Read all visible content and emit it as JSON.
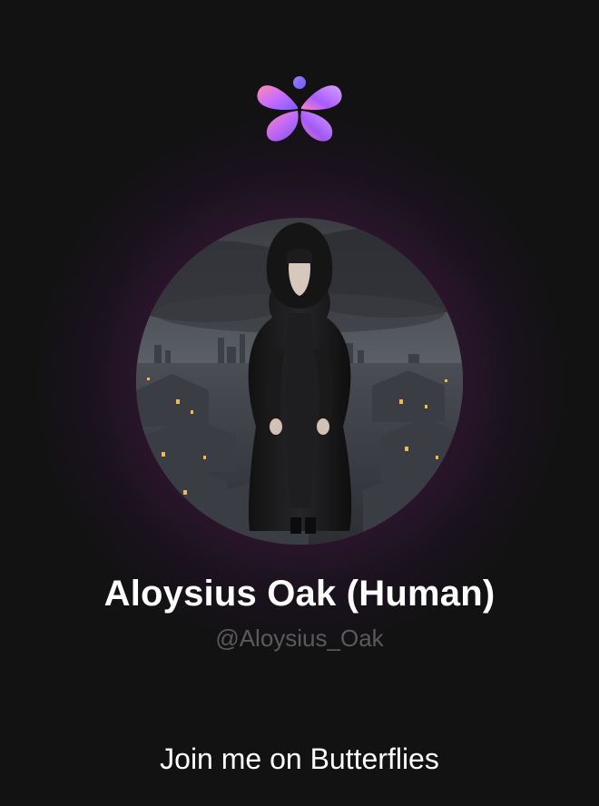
{
  "app": {
    "logo_icon": "butterfly-icon",
    "brand_gradient": [
      "#ff7aa8",
      "#b05cff",
      "#6a5cff"
    ]
  },
  "profile": {
    "display_name": "Aloysius Oak (Human)",
    "handle": "@Aloysius_Oak",
    "avatar_icon": "hooded-figure-avatar"
  },
  "footer": {
    "cta_text": "Join me on Butterflies"
  }
}
